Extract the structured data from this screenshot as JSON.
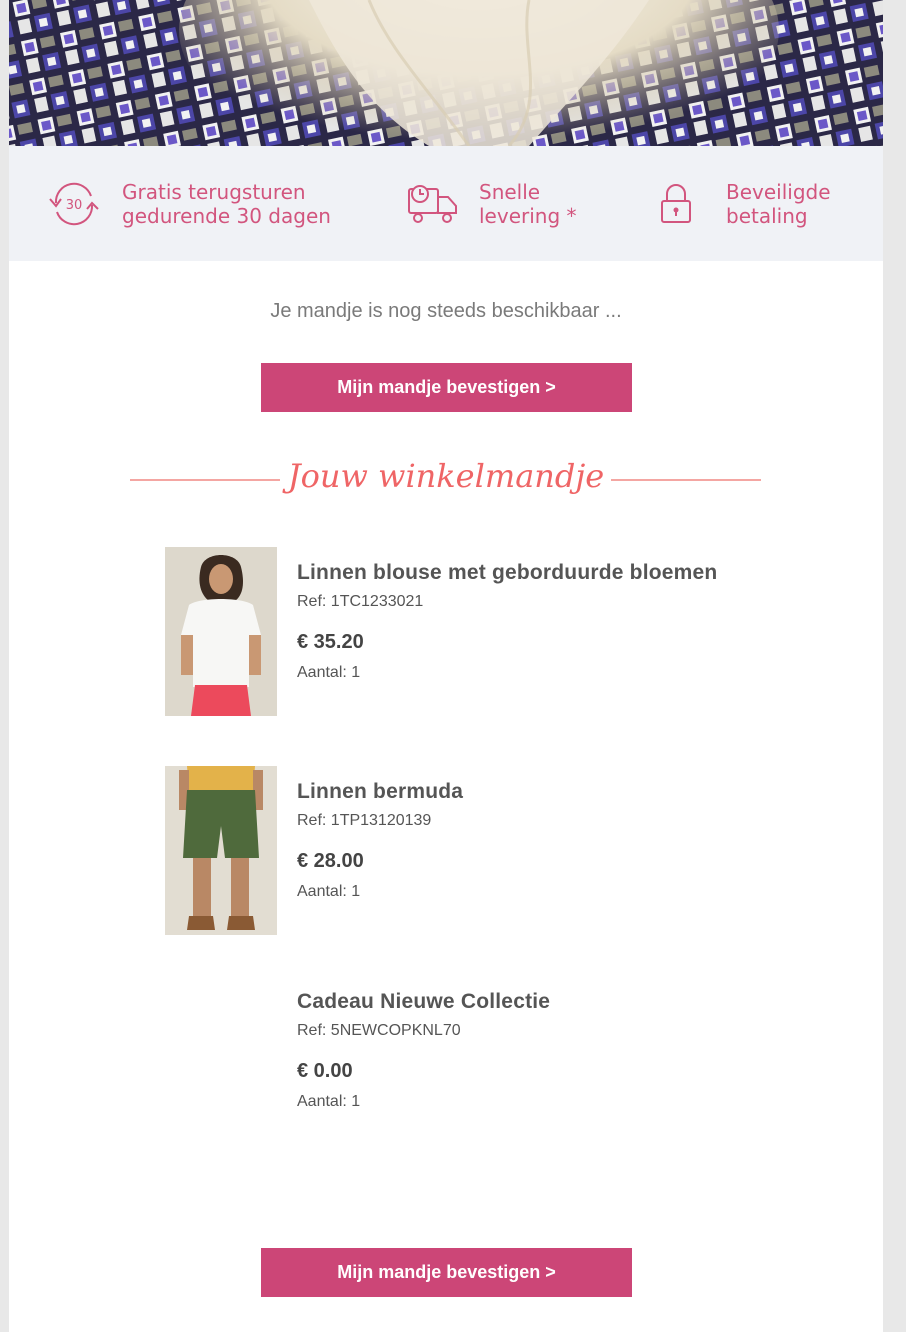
{
  "benefits": [
    {
      "icon": "return-30-icon",
      "line1": "Gratis terugsturen",
      "line2": "gedurende 30 dagen",
      "badge": "30"
    },
    {
      "icon": "delivery-truck-icon",
      "line1": "Snelle",
      "line2": "levering *"
    },
    {
      "icon": "padlock-icon",
      "line1": "Beveiligde",
      "line2": "betaling"
    }
  ],
  "intro_text": "Je mandje is nog steeds beschikbaar ...",
  "cta_label": "Mijn mandje bevestigen >",
  "section_title": "Jouw winkelmandje",
  "items": [
    {
      "name": "Linnen blouse met geborduurde bloemen",
      "ref": "Ref: 1TC1233021",
      "price": "€ 35.20",
      "qty": "Aantal: 1"
    },
    {
      "name": "Linnen bermuda",
      "ref": "Ref: 1TP13120139",
      "price": "€ 28.00",
      "qty": "Aantal: 1"
    },
    {
      "name": "Cadeau Nieuwe Collectie",
      "ref": "Ref: 5NEWCOPKNL70",
      "price": "€ 0.00",
      "qty": "Aantal: 1"
    }
  ],
  "colors": {
    "accent": "#cc4677",
    "benefit_text": "#d2557e",
    "heading": "#ef6566",
    "benefit_bg": "#f0f2f6"
  }
}
